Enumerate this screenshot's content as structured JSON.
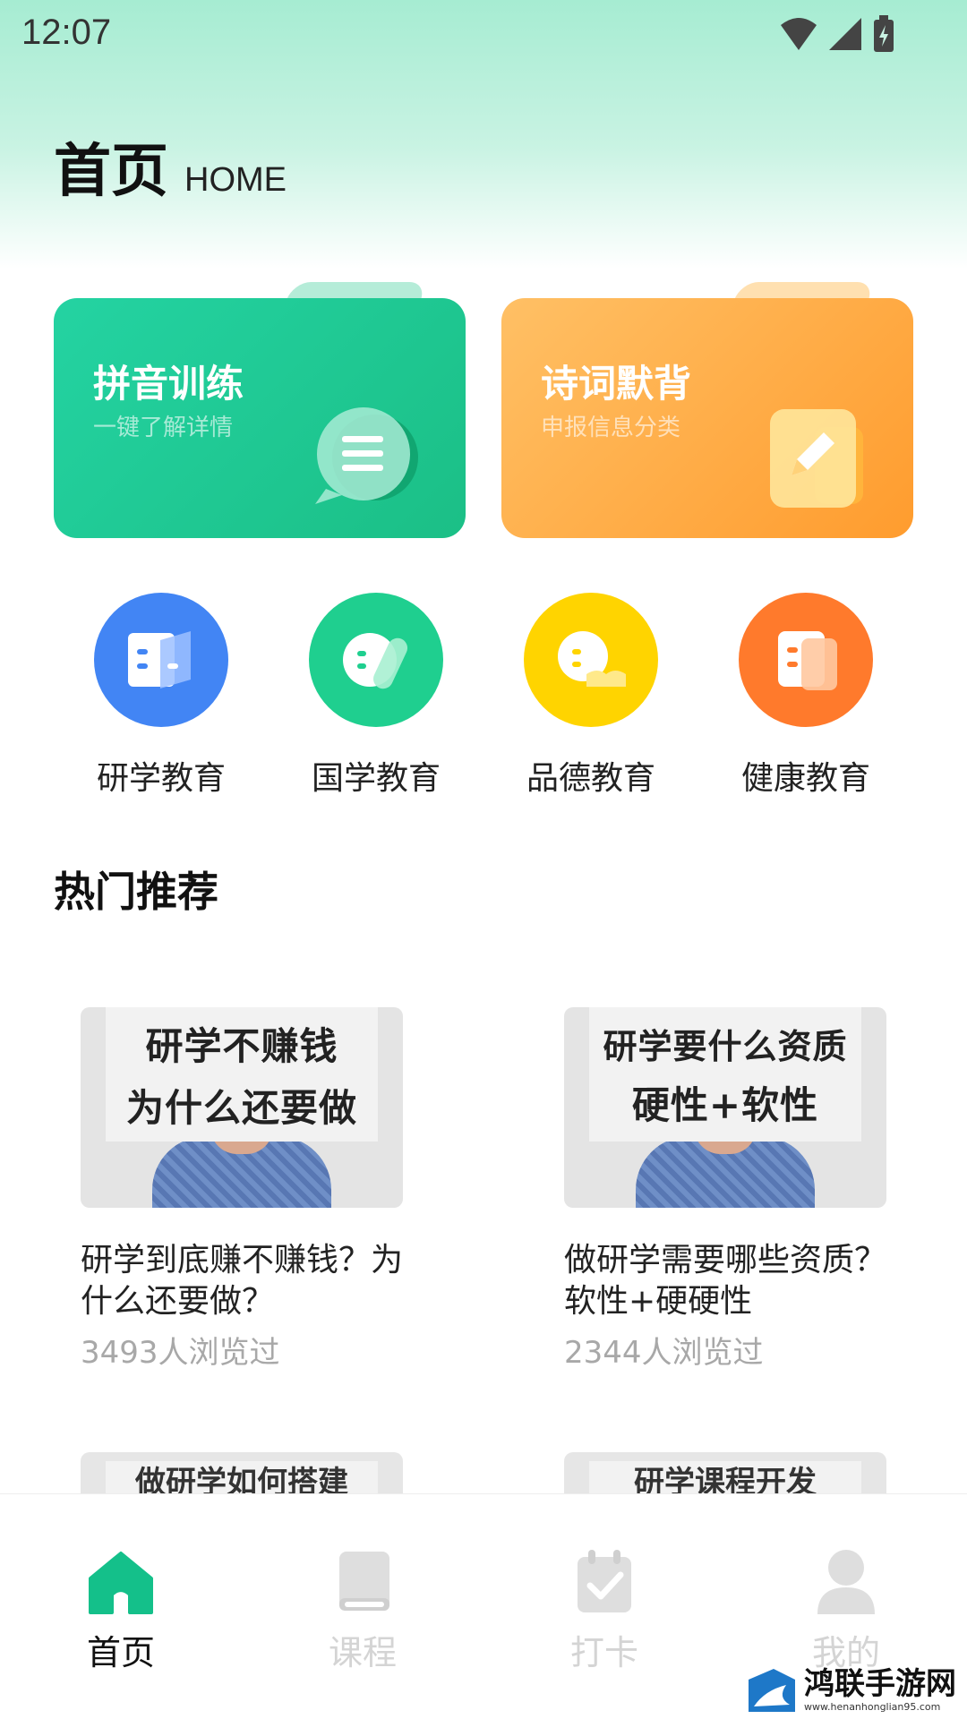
{
  "status": {
    "time": "12:07"
  },
  "header": {
    "title_zh": "首页",
    "title_en": "HOME"
  },
  "feature_cards": [
    {
      "title": "拼音训练",
      "subtitle": "一键了解详情",
      "icon": "chat-bubble-icon"
    },
    {
      "title": "诗词默背",
      "subtitle": "申报信息分类",
      "icon": "edit-note-icon"
    }
  ],
  "categories": [
    {
      "label": "研学教育",
      "color": "#4285f4",
      "icon": "book-card-icon"
    },
    {
      "label": "国学教育",
      "color": "#1fcf8f",
      "icon": "chat-card-icon"
    },
    {
      "label": "品德教育",
      "color": "#ffd400",
      "icon": "message-card-icon"
    },
    {
      "label": "健康教育",
      "color": "#ff7a2c",
      "icon": "list-card-icon"
    }
  ],
  "section": {
    "title": "热门推荐"
  },
  "recommendations": [
    {
      "thumb_lines": [
        "研学不赚钱",
        "为什么还要做"
      ],
      "title": "研学到底赚不赚钱？为什么还要做？",
      "views": "3493人浏览过"
    },
    {
      "thumb_lines": [
        "研学要什么资质",
        "硬性+软性"
      ],
      "title": "做研学需要哪些资质？软性+硬硬性",
      "views": "2344人浏览过"
    }
  ],
  "partial_items": [
    {
      "thumb_text": "做研学如何搭建"
    },
    {
      "thumb_text": "研学课程开发"
    }
  ],
  "tabbar": {
    "items": [
      {
        "label": "首页",
        "icon": "home-icon",
        "active": true
      },
      {
        "label": "课程",
        "icon": "book-icon",
        "active": false
      },
      {
        "label": "打卡",
        "icon": "calendar-check-icon",
        "active": false
      },
      {
        "label": "我的",
        "icon": "user-icon",
        "active": false
      }
    ]
  },
  "watermark": {
    "name": "鸿联手游网",
    "url": "www.henanhonglian95.com"
  },
  "colors": {
    "accent": "#14c08a",
    "inactive": "#d4d4d4"
  }
}
